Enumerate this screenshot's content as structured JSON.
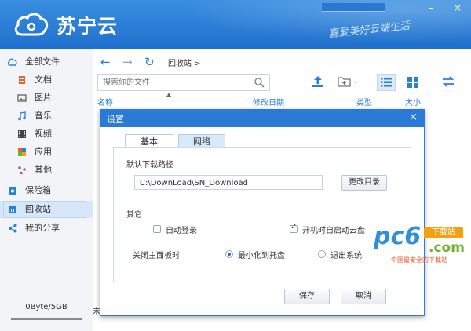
{
  "app": {
    "logo_text": "苏宁云",
    "slogan": "喜爱美好云端生活",
    "accent": "#2a7bd6",
    "window_controls": [
      "–",
      "×"
    ]
  },
  "sidebar": {
    "items": [
      {
        "label": "全部文件",
        "icon": "cloud-icon"
      },
      {
        "label": "文档",
        "icon": "document-icon"
      },
      {
        "label": "图片",
        "icon": "image-icon"
      },
      {
        "label": "音乐",
        "icon": "music-icon"
      },
      {
        "label": "视频",
        "icon": "video-icon"
      },
      {
        "label": "应用",
        "icon": "app-icon"
      },
      {
        "label": "其他",
        "icon": "other-icon"
      },
      {
        "label": "保险箱",
        "icon": "safe-icon"
      },
      {
        "label": "回收站",
        "icon": "trash-icon",
        "active": true
      },
      {
        "label": "我的分享",
        "icon": "share-icon"
      }
    ],
    "storage": "0Byte/5GB"
  },
  "toolbar": {
    "back": "←",
    "forward": "→",
    "refresh": "↻",
    "breadcrumb": "回收站  >",
    "search_placeholder": "搜索你的文件"
  },
  "columns": {
    "name": "名称",
    "modified": "修改日期",
    "type": "类型",
    "size": "大小"
  },
  "content_strip": "未",
  "dialog": {
    "title": "设置",
    "close": "×",
    "tabs": [
      {
        "label": "基本",
        "active": true
      },
      {
        "label": "网络",
        "active": false
      }
    ],
    "download_path_label": "默认下载路径",
    "download_path_value": "C:\\DownLoad\\SN_Download",
    "change_dir_button": "更改目录",
    "other_label": "其它",
    "auto_login_label": "自动登录",
    "auto_login_checked": false,
    "autostart_label": "开机时自启动云盘",
    "autostart_checked": true,
    "close_panel_label": "关闭主面板时",
    "minimize_label": "最小化到托盘",
    "minimize_selected": true,
    "exit_label": "退出系统",
    "exit_selected": false,
    "save_button": "保存",
    "cancel_button": "取消"
  },
  "watermark": {
    "brand": "pc6",
    "badge": "下载站",
    "domain": ".com",
    "tagline": "中国最安全的下载站"
  }
}
